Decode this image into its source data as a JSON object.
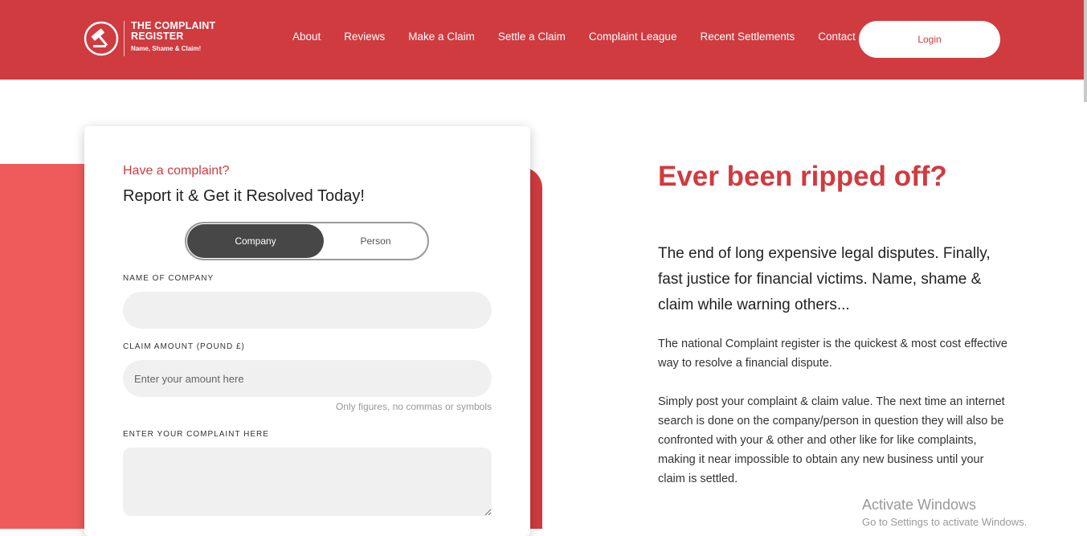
{
  "header": {
    "brand_title": "THE COMPLAINT REGISTER",
    "brand_tagline": "Name, Shame & Claim!",
    "nav": [
      "About",
      "Reviews",
      "Make a Claim",
      "Settle a Claim",
      "Complaint League",
      "Recent Settlements",
      "Contact"
    ],
    "login_label": "Login"
  },
  "form": {
    "eyebrow": "Have a complaint?",
    "title": "Report it & Get it Resolved Today!",
    "toggle": {
      "selected": "Company",
      "other": "Person"
    },
    "company_label": "NAME OF COMPANY",
    "company_value": "",
    "amount_label": "CLAIM AMOUNT (POUND £)",
    "amount_placeholder": "Enter your amount here",
    "amount_hint": "Only figures, no commas or symbols",
    "complaint_label": "ENTER YOUR COMPLAINT HERE",
    "complaint_value": ""
  },
  "hero": {
    "title": "Ever been ripped off?",
    "subtitle": "The end of long expensive legal disputes. Finally, fast justice for financial victims. Name, shame & claim while warning others...",
    "paragraph1": "The national Complaint register is the quickest & most cost effective way to resolve a financial dispute.",
    "paragraph2": "Simply post your complaint & claim value. The next time an internet search is done on the company/person in question they will also be confronted with your & other and other like for like complaints, making it near impossible to obtain any new business until your claim is settled."
  },
  "watermark": {
    "title": "Activate Windows",
    "subtitle": "Go to Settings to activate Windows."
  },
  "colors": {
    "brand_red": "#cf3b3f",
    "band_red": "#ef5b5b",
    "toggle_dark": "#474747",
    "input_bg": "#f0f0f0"
  },
  "icons": [
    "gavel-icon"
  ]
}
